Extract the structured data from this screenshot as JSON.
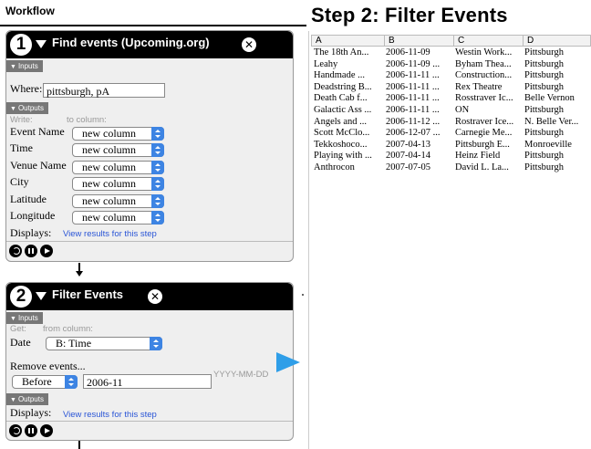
{
  "workflow": {
    "title": "Workflow"
  },
  "output": {
    "title": "Step 2: Filter Events"
  },
  "step1": {
    "number": "1",
    "title": "Find events (Upcoming.org)",
    "inputs_tag": "Inputs",
    "where_label": "Where:",
    "where_value": "pittsburgh, pA",
    "outputs_tag": "Outputs",
    "write_label": "Write:",
    "to_column_label": "to column:",
    "fields": [
      {
        "label": "Event Name",
        "value": "new column"
      },
      {
        "label": "Time",
        "value": "new column"
      },
      {
        "label": "Venue Name",
        "value": "new column"
      },
      {
        "label": "City",
        "value": "new column"
      },
      {
        "label": "Latitude",
        "value": "new column"
      },
      {
        "label": "Longitude",
        "value": "new column"
      }
    ],
    "displays_label": "Displays:",
    "view_link": "View results for this step"
  },
  "step2": {
    "number": "2",
    "title": "Filter Events",
    "inputs_tag": "Inputs",
    "get_label": "Get:",
    "from_column_label": "from column:",
    "date_label": "Date",
    "date_value": "B: Time",
    "remove_label": "Remove events...",
    "before_value": "Before",
    "date_input": "2006-11",
    "date_hint": "YYYY-MM-DD",
    "outputs_tag": "Outputs",
    "displays_label": "Displays:",
    "view_link": "View results for this step"
  },
  "table": {
    "columns": [
      "A",
      "B",
      "C",
      "D"
    ],
    "rows": [
      [
        "The 18th An...",
        "2006-11-09",
        "Westin Work...",
        "Pittsburgh"
      ],
      [
        "Leahy",
        "2006-11-09 ...",
        "Byham Thea...",
        "Pittsburgh"
      ],
      [
        "Handmade ...",
        "2006-11-11 ...",
        "Construction...",
        "Pittsburgh"
      ],
      [
        "Deadstring B...",
        "2006-11-11 ...",
        "Rex Theatre",
        "Pittsburgh"
      ],
      [
        "Death Cab f...",
        "2006-11-11 ...",
        "Rosstraver Ic...",
        "Belle Vernon"
      ],
      [
        "Galactic Ass ...",
        "2006-11-11 ...",
        "ON",
        "Pittsburgh"
      ],
      [
        "Angels and ...",
        "2006-11-12 ...",
        "Rostraver Ice...",
        "N. Belle Ver..."
      ],
      [
        "Scott McClo...",
        "2006-12-07 ...",
        "Carnegie Me...",
        "Pittsburgh"
      ],
      [
        "Tekkoshoco...",
        "2007-04-13",
        "Pittsburgh E...",
        "Monroeville"
      ],
      [
        "Playing with ...",
        "2007-04-14",
        "Heinz Field",
        "Pittsburgh"
      ],
      [
        "Anthrocon",
        "2007-07-05",
        "David L. La...",
        "Pittsburgh"
      ]
    ]
  },
  "colors": {
    "accent": "#3d84e3",
    "link": "#2a55d6",
    "arrow": "#2f9ee8"
  }
}
